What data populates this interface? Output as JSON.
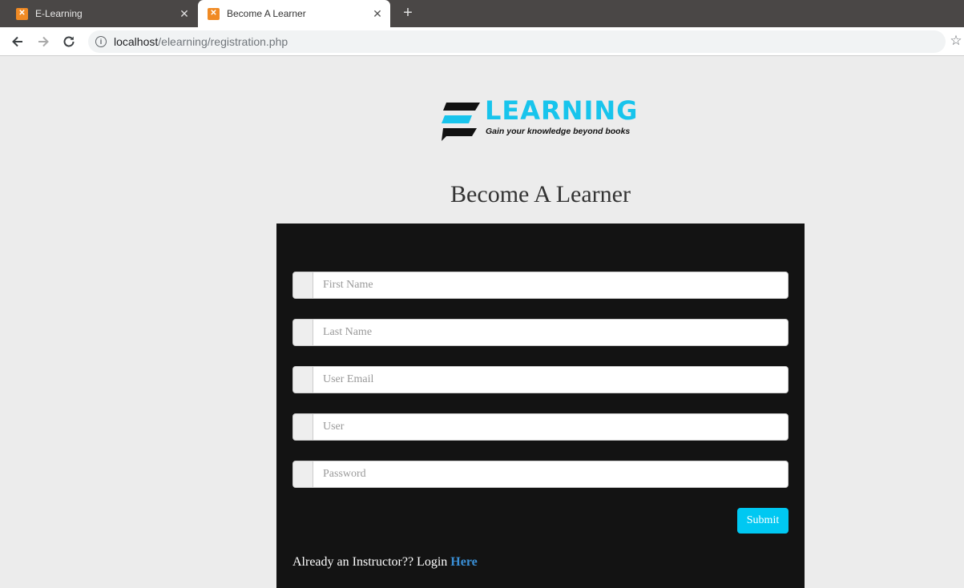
{
  "browser": {
    "tabs": [
      {
        "label": "E-Learning",
        "active": false
      },
      {
        "label": "Become A Learner",
        "active": true
      }
    ],
    "url_host": "localhost",
    "url_path": "/elearning/registration.php"
  },
  "logo": {
    "wordmark": "LEARNING",
    "tagline": "Gain your knowledge beyond books"
  },
  "page": {
    "title": "Become A Learner"
  },
  "form": {
    "fields": [
      {
        "placeholder": "First Name",
        "value": ""
      },
      {
        "placeholder": "Last Name",
        "value": ""
      },
      {
        "placeholder": "User Email",
        "value": ""
      },
      {
        "placeholder": "User",
        "value": ""
      },
      {
        "placeholder": "Password",
        "value": ""
      }
    ],
    "submit_label": "Submit",
    "login_prompt": "Already an Instructor?? Login ",
    "login_link": "Here"
  },
  "colors": {
    "accent": "#00c8f2",
    "panel": "#131313",
    "page_bg": "#ececec",
    "link": "#3a8fd6"
  }
}
